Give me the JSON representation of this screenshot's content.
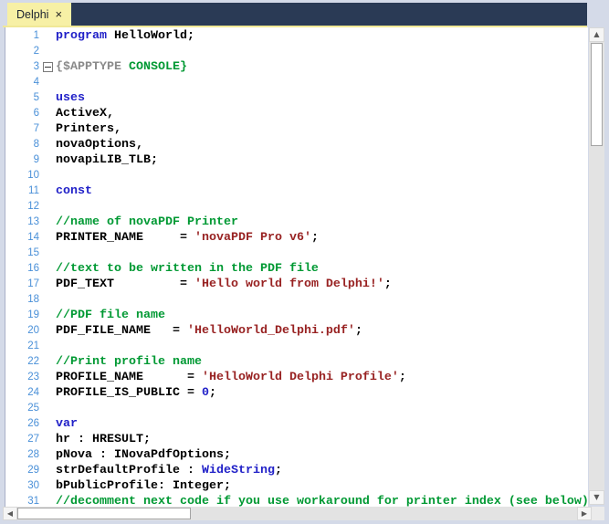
{
  "tab": {
    "label": "Delphi",
    "close_glyph": "×"
  },
  "colors": {
    "tab_bar_bg": "#2A3A55",
    "tab_bg": "#F7F0A5",
    "tab_text": "#1B2230",
    "tab_underline": "#F0E896",
    "frame_bg": "#D4DAE8",
    "editor_bg": "#FFFFFF",
    "line_number": "#4A90D8",
    "keyword": "#2121C8",
    "plain": "#000000",
    "comment": "#009933",
    "string": "#982222",
    "number": "#2121C8",
    "directive": "#8A8A8A",
    "directive_value": "#009933",
    "scroll_track": "#E3E3E3",
    "scroll_thumb": "#FFFFFF",
    "scroll_button": "#F5F5F5",
    "scroll_arrow": "#5A5A5A"
  },
  "scrollbar": {
    "up_arrow": "▲",
    "down_arrow": "▼",
    "left_arrow": "◀",
    "right_arrow": "▶"
  },
  "editor": {
    "lines": [
      {
        "n": 1,
        "seg": [
          {
            "s": "kw",
            "t": "program"
          },
          {
            "s": "pl",
            "t": " HelloWorld;"
          }
        ]
      },
      {
        "n": 2,
        "seg": []
      },
      {
        "n": 3,
        "fold": true,
        "seg": [
          {
            "s": "dir",
            "t": "{$APPTYPE "
          },
          {
            "s": "dirval",
            "t": "CONSOLE}"
          }
        ]
      },
      {
        "n": 4,
        "seg": []
      },
      {
        "n": 5,
        "seg": [
          {
            "s": "kw",
            "t": "uses"
          }
        ]
      },
      {
        "n": 6,
        "seg": [
          {
            "s": "pl",
            "t": "ActiveX,"
          }
        ]
      },
      {
        "n": 7,
        "seg": [
          {
            "s": "pl",
            "t": "Printers,"
          }
        ]
      },
      {
        "n": 8,
        "seg": [
          {
            "s": "pl",
            "t": "novaOptions,"
          }
        ]
      },
      {
        "n": 9,
        "seg": [
          {
            "s": "pl",
            "t": "novapiLIB_TLB;"
          }
        ]
      },
      {
        "n": 10,
        "seg": []
      },
      {
        "n": 11,
        "seg": [
          {
            "s": "kw",
            "t": "const"
          }
        ]
      },
      {
        "n": 12,
        "seg": []
      },
      {
        "n": 13,
        "seg": [
          {
            "s": "cm",
            "t": "//name of novaPDF Printer"
          }
        ]
      },
      {
        "n": 14,
        "seg": [
          {
            "s": "pl",
            "t": "PRINTER_NAME     = "
          },
          {
            "s": "str",
            "t": "'novaPDF Pro v6'"
          },
          {
            "s": "pl",
            "t": ";"
          }
        ]
      },
      {
        "n": 15,
        "seg": []
      },
      {
        "n": 16,
        "seg": [
          {
            "s": "cm",
            "t": "//text to be written in the PDF file"
          }
        ]
      },
      {
        "n": 17,
        "seg": [
          {
            "s": "pl",
            "t": "PDF_TEXT         = "
          },
          {
            "s": "str",
            "t": "'Hello world from Delphi!'"
          },
          {
            "s": "pl",
            "t": ";"
          }
        ]
      },
      {
        "n": 18,
        "seg": []
      },
      {
        "n": 19,
        "seg": [
          {
            "s": "cm",
            "t": "//PDF file name"
          }
        ]
      },
      {
        "n": 20,
        "seg": [
          {
            "s": "pl",
            "t": "PDF_FILE_NAME   = "
          },
          {
            "s": "str",
            "t": "'HelloWorld_Delphi.pdf'"
          },
          {
            "s": "pl",
            "t": ";"
          }
        ]
      },
      {
        "n": 21,
        "seg": []
      },
      {
        "n": 22,
        "seg": [
          {
            "s": "cm",
            "t": "//Print profile name"
          }
        ]
      },
      {
        "n": 23,
        "seg": [
          {
            "s": "pl",
            "t": "PROFILE_NAME      = "
          },
          {
            "s": "str",
            "t": "'HelloWorld Delphi Profile'"
          },
          {
            "s": "pl",
            "t": ";"
          }
        ]
      },
      {
        "n": 24,
        "seg": [
          {
            "s": "pl",
            "t": "PROFILE_IS_PUBLIC = "
          },
          {
            "s": "num",
            "t": "0"
          },
          {
            "s": "pl",
            "t": ";"
          }
        ]
      },
      {
        "n": 25,
        "seg": []
      },
      {
        "n": 26,
        "seg": [
          {
            "s": "kw",
            "t": "var"
          }
        ]
      },
      {
        "n": 27,
        "seg": [
          {
            "s": "pl",
            "t": "hr : HRESULT;"
          }
        ]
      },
      {
        "n": 28,
        "seg": [
          {
            "s": "pl",
            "t": "pNova : INovaPdfOptions;"
          }
        ]
      },
      {
        "n": 29,
        "seg": [
          {
            "s": "pl",
            "t": "strDefaultProfile : "
          },
          {
            "s": "kw",
            "t": "WideString"
          },
          {
            "s": "pl",
            "t": ";"
          }
        ]
      },
      {
        "n": 30,
        "seg": [
          {
            "s": "pl",
            "t": "bPublicProfile: Integer;"
          }
        ]
      },
      {
        "n": 31,
        "seg": [
          {
            "s": "cm",
            "t": "//decomment next code if you use workaround for printer index (see below)"
          }
        ]
      }
    ]
  }
}
